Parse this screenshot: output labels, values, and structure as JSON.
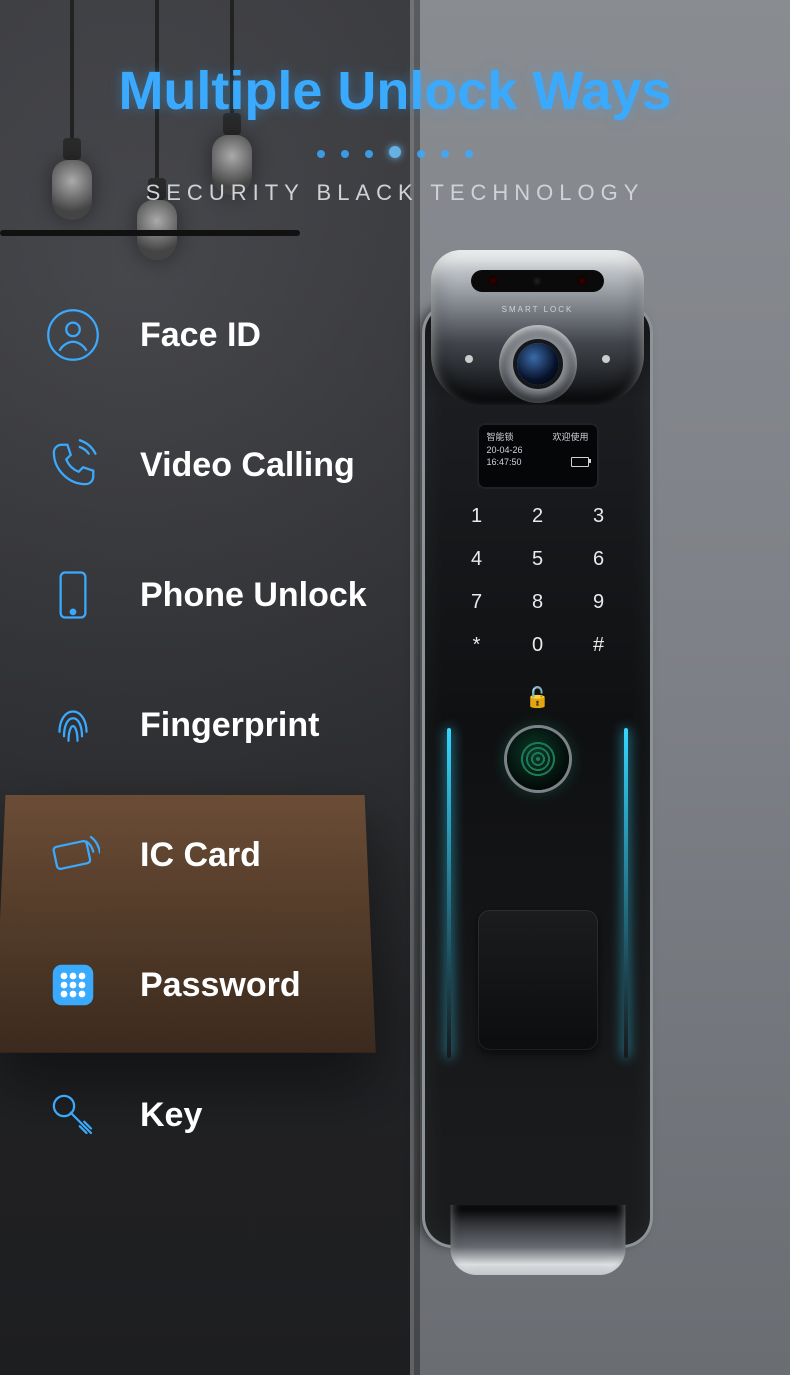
{
  "title": "Multiple Unlock Ways",
  "subtitle": "SECURITY BLACK TECHNOLOGY",
  "features": [
    {
      "icon": "face-id-icon",
      "label": "Face ID"
    },
    {
      "icon": "phone-call-icon",
      "label": "Video Calling"
    },
    {
      "icon": "smartphone-icon",
      "label": "Phone Unlock"
    },
    {
      "icon": "fingerprint-icon",
      "label": "Fingerprint"
    },
    {
      "icon": "card-swipe-icon",
      "label": "IC Card"
    },
    {
      "icon": "keypad-grid-icon",
      "label": "Password"
    },
    {
      "icon": "key-icon",
      "label": "Key"
    }
  ],
  "device": {
    "brand": "SMART LOCK",
    "screen": {
      "line1_left": "智能锁",
      "line1_right": "欢迎使用",
      "date": "20-04-26",
      "time": "16:47:50"
    },
    "keypad": [
      "1",
      "2",
      "3",
      "4",
      "5",
      "6",
      "7",
      "8",
      "9",
      "*",
      "0",
      "#"
    ],
    "lock_glyph": "🔓"
  },
  "colors": {
    "accent": "#3aaaff",
    "glow": "#36d6ff"
  }
}
